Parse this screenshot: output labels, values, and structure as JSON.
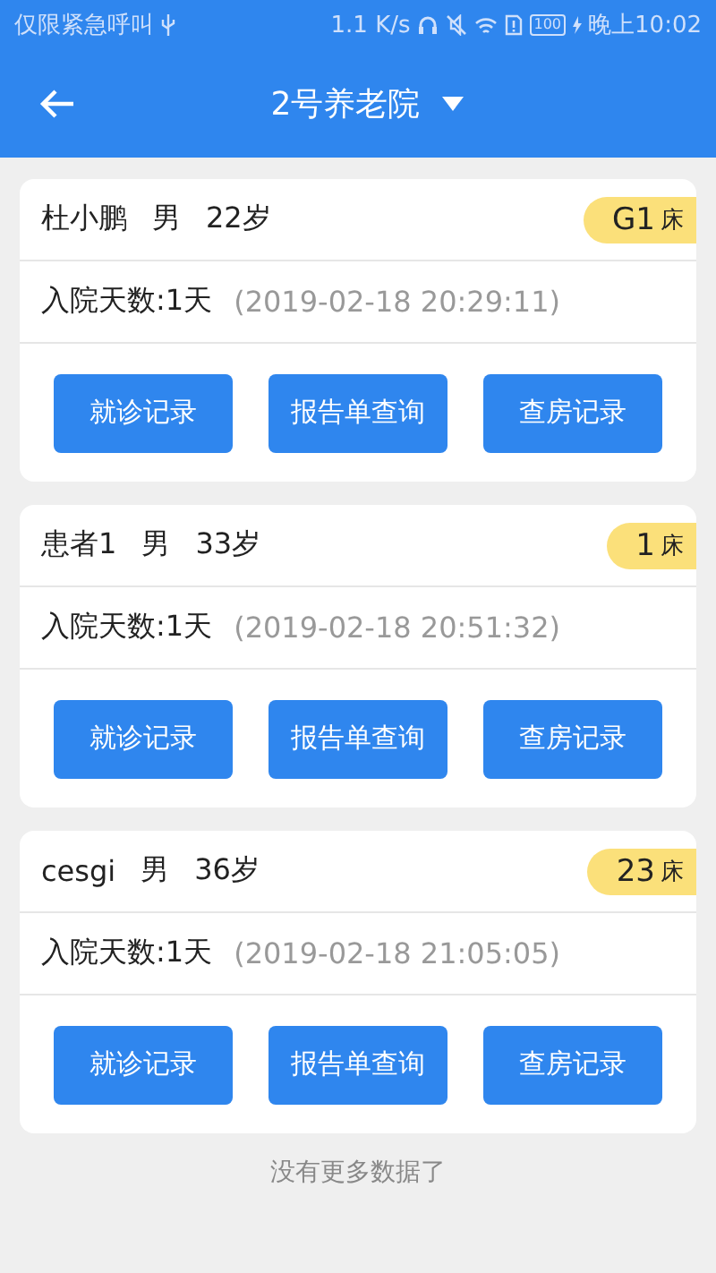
{
  "status_bar": {
    "carrier": "仅限紧急呼叫",
    "speed": "1.1 K/s",
    "battery": "100",
    "time": "晚上10:02"
  },
  "header": {
    "title": "2号养老院"
  },
  "patients": [
    {
      "name": "杜小鹏",
      "sex": "男",
      "age": "22岁",
      "bed": "G1",
      "bed_unit": "床",
      "days": "入院天数:1天",
      "admitted": "(2019-02-18 20:29:11)",
      "buttons": [
        "就诊记录",
        "报告单查询",
        "查房记录"
      ]
    },
    {
      "name": "患者1",
      "sex": "男",
      "age": "33岁",
      "bed": "1",
      "bed_unit": "床",
      "days": "入院天数:1天",
      "admitted": "(2019-02-18 20:51:32)",
      "buttons": [
        "就诊记录",
        "报告单查询",
        "查房记录"
      ]
    },
    {
      "name": "cesgi",
      "sex": "男",
      "age": "36岁",
      "bed": "23",
      "bed_unit": "床",
      "days": "入院天数:1天",
      "admitted": "(2019-02-18 21:05:05)",
      "buttons": [
        "就诊记录",
        "报告单查询",
        "查房记录"
      ]
    }
  ],
  "footer": "没有更多数据了"
}
